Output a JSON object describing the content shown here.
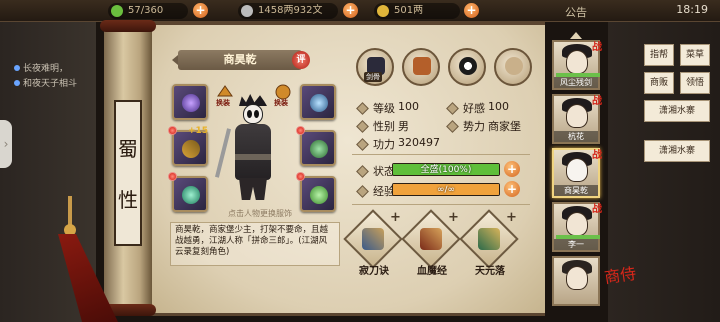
{
  "topbar": {
    "stamina": "57/360",
    "silver": "1458两932文",
    "gold": "501两",
    "notice": "公告",
    "time": "18:19"
  },
  "chat": {
    "line1": "长夜难明，",
    "line2": "和夜天子相斗"
  },
  "scroll_label": [
    "蜀",
    "性"
  ],
  "character": {
    "name": "商昊乾",
    "edit_label": "评",
    "swap_left": "换装",
    "swap_right": "换装",
    "equip_bonus": "+15",
    "hint": "点击人物更换服饰",
    "description": "商昊乾，商家堡少主，打架不要命，且越战越勇，江湖人称「拼命三郎」。(江湖风云录复刻角色)"
  },
  "top_skills": [
    {
      "name": "奇剑",
      "tag": "剑骨"
    },
    {
      "name": "shield-skill"
    },
    {
      "name": "yinyang-skill"
    },
    {
      "name": "body-skill"
    }
  ],
  "stats": {
    "level_label": "等级",
    "level": "100",
    "favor_label": "好感",
    "favor": "100",
    "gender_label": "性别",
    "gender": "男",
    "faction_label": "势力",
    "faction": "商家堡",
    "power_label": "功力",
    "power": "320497",
    "status_label": "状态",
    "status": "全盛(100%)",
    "status_pct": 1.0,
    "exp_label": "经验",
    "exp": "∞/∞",
    "exp_pct": 1.0
  },
  "skills": [
    {
      "name": "寂刀诀"
    },
    {
      "name": "血魔经"
    },
    {
      "name": "天元落"
    }
  ],
  "heroes": [
    {
      "name": "风尘残剑"
    },
    {
      "name": "杭花"
    },
    {
      "name": "商昊乾"
    },
    {
      "name": "李一"
    },
    {
      "name": ""
    }
  ],
  "menu": {
    "btn1": "指帮",
    "btn2": "菜草",
    "btn3": "商贩",
    "btn4": "领悟",
    "btn5": "潇湘水寨",
    "btn6": "潇湘水寨"
  },
  "stamp": "商侍",
  "colors": {
    "status_fill": "#5fbf3a",
    "exp_fill": "#f0a23c",
    "accent_red": "#d8271a"
  }
}
